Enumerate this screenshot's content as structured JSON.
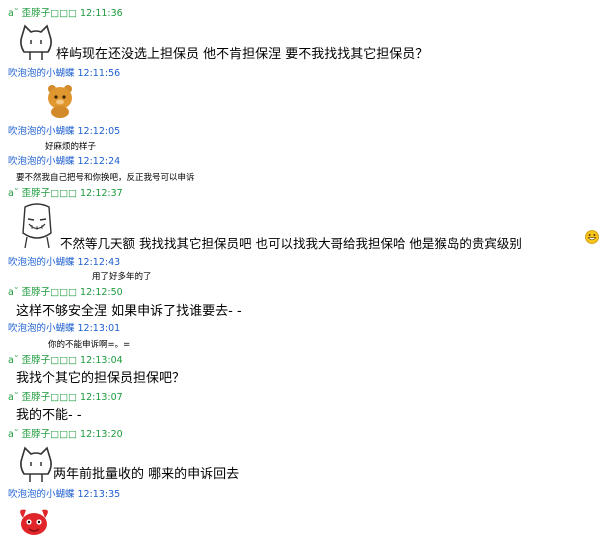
{
  "messages": [
    {
      "sender": "a˘ 歪脖子□□□",
      "time": "12:11:36",
      "text": "梓屿现在还没选上担保员 他不肯担保涅 要不我找找其它担保员？",
      "sticker": "cat-cartoon"
    },
    {
      "sender": "吹泡泡的小蝴蝶",
      "time": "12:11:56",
      "sticker": "bear-sticker"
    },
    {
      "sender": "吹泡泡的小蝴蝶",
      "time": "12:12:05",
      "text": "好麻烦的样子"
    },
    {
      "sender": "吹泡泡的小蝴蝶",
      "time": "12:12:24",
      "text": "要不然我自己把号和你换吧，反正我号可以申诉"
    },
    {
      "sender": "a˘ 歪脖子□□□",
      "time": "12:12:37",
      "text": "不然等几天额 我找找其它担保员吧 也可以找我大哥给我担保哈 他是猴岛的贵宾级别",
      "sticker": "face-cartoon"
    },
    {
      "sender": "吹泡泡的小蝴蝶",
      "time": "12:12:43",
      "text": "用了好多年的了"
    },
    {
      "sender": "a˘ 歪脖子□□□",
      "time": "12:12:50",
      "text": "这样不够安全涅 如果申诉了找谁要去- -"
    },
    {
      "sender": "吹泡泡的小蝴蝶",
      "time": "12:13:01",
      "text": "你的不能申诉啊=。="
    },
    {
      "sender": "a˘ 歪脖子□□□",
      "time": "12:13:04",
      "text": "我找个其它的担保员担保吧？"
    },
    {
      "sender": "a˘ 歪脖子□□□",
      "time": "12:13:07",
      "text": "我的不能- -"
    },
    {
      "sender": "a˘ 歪脖子□□□",
      "time": "12:13:20",
      "text": "两年前批量收的 哪来的申诉回去",
      "sticker": "cat-cartoon"
    },
    {
      "sender": "吹泡泡的小蝴蝶",
      "time": "12:13:35",
      "sticker": "red-creature-sticker"
    }
  ],
  "icons": [
    "cat-cartoon",
    "bear-sticker",
    "face-cartoon",
    "grin-emoji",
    "red-creature-sticker"
  ],
  "colors": {
    "sender_a": "#1d9b3c",
    "sender_b": "#1d5fd0",
    "text": "#000000"
  }
}
